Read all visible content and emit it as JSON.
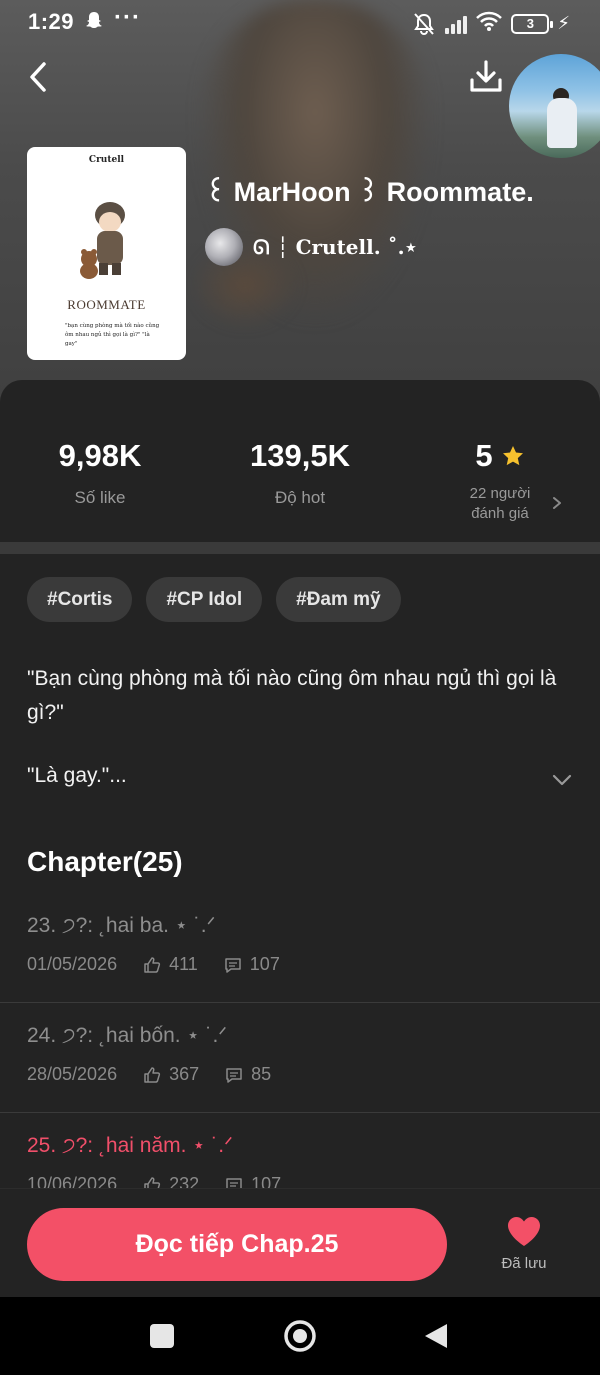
{
  "status_bar": {
    "time": "1:29",
    "overflow": "···",
    "battery_level": "3"
  },
  "header": {
    "back_icon": "chevron-left-icon",
    "download_icon": "download-icon"
  },
  "story": {
    "title": "꒰ MarHoon ꒱ Roommate.",
    "author": "ᘏ ┆ Crutell. ˚.⋆",
    "cover": {
      "author": "Crutell",
      "title": "ROOMMATE",
      "quote": "\"bạn cùng phòng mà tối nào cũng ôm nhau ngủ thì gọi là gì?\" \"là gay\""
    }
  },
  "stats": {
    "likes_value": "9,98K",
    "likes_label": "Số like",
    "hot_value": "139,5K",
    "hot_label": "Độ hot",
    "rating_value": "5",
    "rating_label_line1": "22 người",
    "rating_label_line2": "đánh giá"
  },
  "tags": [
    "#Cortis",
    "#CP Idol",
    "#Đam mỹ"
  ],
  "description": {
    "line1": "\"Bạn cùng phòng mà tối nào cũng ôm nhau ngủ thì gọi là gì?\"",
    "line2": "\"Là gay.\"..."
  },
  "chapters_heading": "Chapter(25)",
  "chapters": [
    {
      "title": "23. ੭?: ˛hai ba. ⋆ ˙.ᐟ",
      "date": "01/05/2026",
      "likes": "411",
      "comments": "107"
    },
    {
      "title": "24. ੭?: ˛hai bốn. ⋆ ˙.ᐟ",
      "date": "28/05/2026",
      "likes": "367",
      "comments": "85"
    },
    {
      "title": "25. ੭?: ˛hai năm. ⋆ ˙.ᐟ",
      "date": "10/06/2026",
      "likes": "232",
      "comments": "107"
    }
  ],
  "actions": {
    "read_label": "Đọc tiếp Chap.25",
    "saved_label": "Đã lưu"
  },
  "colors": {
    "accent": "#f35067",
    "star": "#f6c12e",
    "sheet_bg": "#232323"
  }
}
